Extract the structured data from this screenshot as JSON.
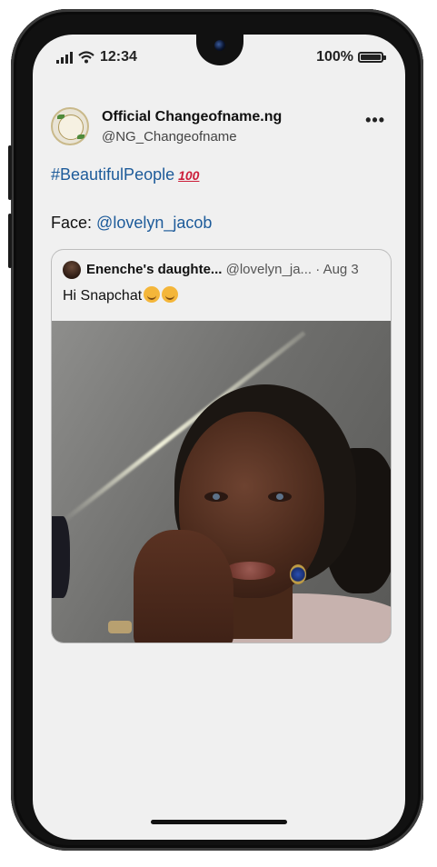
{
  "status_bar": {
    "time": "12:34",
    "battery_text": "100%",
    "battery_level": 1.0
  },
  "post": {
    "display_name": "Official Changeofname.ng",
    "handle": "@NG_Changeofname",
    "more_label": "•••",
    "hashtag": "#BeautifulPeople",
    "hundred_emoji": "100",
    "face_label": "Face:",
    "mention": "@lovelyn_jacob"
  },
  "quoted": {
    "name": "Enenche's daughte...",
    "handle": "@lovelyn_ja...",
    "separator": "·",
    "date": "Aug 3",
    "text": "Hi Snapchat"
  },
  "icons": [
    "signal-icon",
    "wifi-icon",
    "battery-icon",
    "more-icon",
    "hundred-points-icon",
    "smiling-face-icon",
    "grinning-face-icon"
  ],
  "colors": {
    "link": "#1d5b9a",
    "screen_bg": "#f0f0f0",
    "frame": "#111111",
    "hundred": "#cc1e3a"
  }
}
